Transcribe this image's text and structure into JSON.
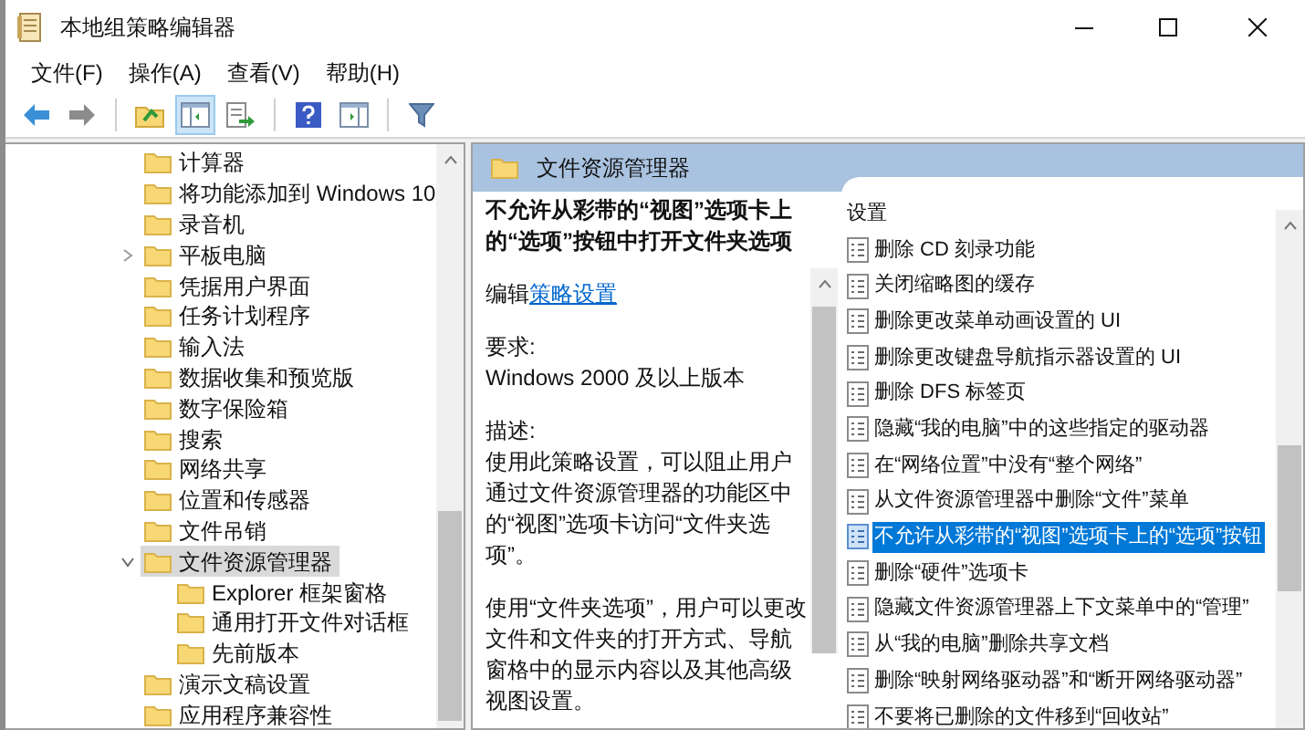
{
  "window": {
    "title": "本地组策略编辑器"
  },
  "menu": [
    "文件(F)",
    "操作(A)",
    "查看(V)",
    "帮助(H)"
  ],
  "toolbar": [
    [
      {
        "kind": "back",
        "pressed": false
      },
      {
        "kind": "forward",
        "pressed": false
      }
    ],
    [
      {
        "kind": "up",
        "pressed": false
      },
      {
        "kind": "tree",
        "pressed": true
      },
      {
        "kind": "export",
        "pressed": false
      }
    ],
    [
      {
        "kind": "help",
        "pressed": false
      },
      {
        "kind": "actions",
        "pressed": false
      }
    ],
    [
      {
        "kind": "filter",
        "pressed": false
      }
    ]
  ],
  "tree": {
    "items": [
      {
        "label": "计算器",
        "kind": "plain",
        "selected": false
      },
      {
        "label": "将功能添加到 Windows 10",
        "kind": "plain",
        "selected": false
      },
      {
        "label": "录音机",
        "kind": "plain",
        "selected": false
      },
      {
        "label": "平板电脑",
        "kind": "collapsed",
        "selected": false
      },
      {
        "label": "凭据用户界面",
        "kind": "plain",
        "selected": false
      },
      {
        "label": "任务计划程序",
        "kind": "plain",
        "selected": false
      },
      {
        "label": "输入法",
        "kind": "plain",
        "selected": false
      },
      {
        "label": "数据收集和预览版",
        "kind": "plain",
        "selected": false
      },
      {
        "label": "数字保险箱",
        "kind": "plain",
        "selected": false
      },
      {
        "label": "搜索",
        "kind": "plain",
        "selected": false
      },
      {
        "label": "网络共享",
        "kind": "plain",
        "selected": false
      },
      {
        "label": "位置和传感器",
        "kind": "plain",
        "selected": false
      },
      {
        "label": "文件吊销",
        "kind": "plain",
        "selected": false
      },
      {
        "label": "文件资源管理器",
        "kind": "expanded",
        "selected": true,
        "children": [
          {
            "label": "Explorer 框架窗格",
            "selected": false
          },
          {
            "label": "通用打开文件对话框",
            "selected": false
          },
          {
            "label": "先前版本",
            "selected": false
          }
        ]
      },
      {
        "label": "演示文稿设置",
        "kind": "plain",
        "selected": false
      },
      {
        "label": "应用程序兼容性",
        "kind": "plain",
        "selected": false
      }
    ]
  },
  "details": {
    "header": "文件资源管理器",
    "policy_title": "不允许从彩带的“视图”选项卡上的“选项”按钮中打开文件夹选项",
    "edit_prefix": "编辑",
    "edit_link": "策略设置",
    "requirements_label": "要求:",
    "requirements": "Windows 2000 及以上版本",
    "description_label": "描述:",
    "paragraphs": [
      "使用此策略设置，可以阻止用户通过文件资源管理器的功能区中的“视图”选项卡访问“文件夹选项”。",
      "使用“文件夹选项”，用户可以更改文件和文件夹的打开方式、导航窗格中的显示内容以及其他高级视图设置。"
    ]
  },
  "settings": {
    "header": "设置",
    "items": [
      {
        "label": "删除 CD 刻录功能",
        "selected": false
      },
      {
        "label": "关闭缩略图的缓存",
        "selected": false
      },
      {
        "label": "删除更改菜单动画设置的 UI",
        "selected": false
      },
      {
        "label": "删除更改键盘导航指示器设置的 UI",
        "selected": false
      },
      {
        "label": "删除 DFS 标签页",
        "selected": false
      },
      {
        "label": "隐藏“我的电脑”中的这些指定的驱动器",
        "selected": false
      },
      {
        "label": "在“网络位置”中没有“整个网络”",
        "selected": false
      },
      {
        "label": "从文件资源管理器中删除“文件”菜单",
        "selected": false
      },
      {
        "label": "不允许从彩带的“视图”选项卡上的“选项”按钮",
        "selected": true
      },
      {
        "label": "删除“硬件”选项卡",
        "selected": false
      },
      {
        "label": "隐藏文件资源管理器上下文菜单中的“管理”",
        "selected": false
      },
      {
        "label": "从“我的电脑”删除共享文档",
        "selected": false
      },
      {
        "label": "删除“映射网络驱动器”和“断开网络驱动器”",
        "selected": false
      },
      {
        "label": "不要将已删除的文件移到“回收站”",
        "selected": false
      }
    ]
  }
}
